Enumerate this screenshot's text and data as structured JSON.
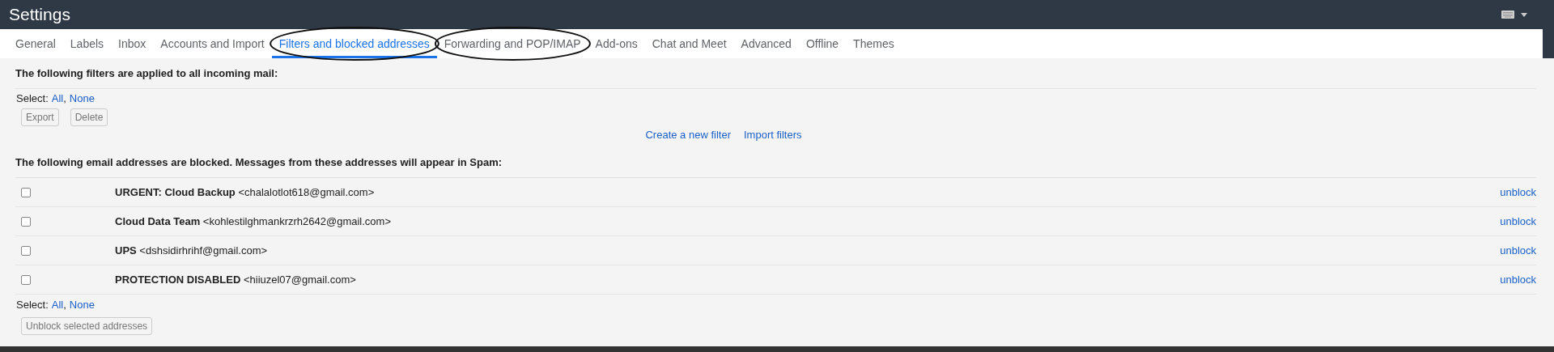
{
  "header": {
    "title": "Settings"
  },
  "tabs": [
    {
      "label": "General",
      "selected": false,
      "circled": false
    },
    {
      "label": "Labels",
      "selected": false,
      "circled": false
    },
    {
      "label": "Inbox",
      "selected": false,
      "circled": false
    },
    {
      "label": "Accounts and Import",
      "selected": false,
      "circled": false
    },
    {
      "label": "Filters and blocked addresses",
      "selected": true,
      "circled": true
    },
    {
      "label": "Forwarding and POP/IMAP",
      "selected": false,
      "circled": true
    },
    {
      "label": "Add-ons",
      "selected": false,
      "circled": false
    },
    {
      "label": "Chat and Meet",
      "selected": false,
      "circled": false
    },
    {
      "label": "Advanced",
      "selected": false,
      "circled": false
    },
    {
      "label": "Offline",
      "selected": false,
      "circled": false
    },
    {
      "label": "Themes",
      "selected": false,
      "circled": false
    }
  ],
  "filters": {
    "heading": "The following filters are applied to all incoming mail:",
    "select_label": "Select:",
    "select_all": "All",
    "separator": ",",
    "select_none": "None",
    "buttons": [
      "Export",
      "Delete"
    ],
    "links": [
      "Create a new filter",
      "Import filters"
    ]
  },
  "blocked": {
    "heading": "The following email addresses are blocked. Messages from these addresses will appear in Spam:",
    "rows": [
      {
        "name": "URGENT: Cloud Backup",
        "email": "<chalalotlot618@gmail.com>",
        "checked": false,
        "action": "unblock"
      },
      {
        "name": "Cloud Data Team",
        "email": "<kohlestilghmankrzrh2642@gmail.com>",
        "checked": false,
        "action": "unblock"
      },
      {
        "name": "UPS",
        "email": "<dshsidirhrihf@gmail.com>",
        "checked": false,
        "action": "unblock"
      },
      {
        "name": "PROTECTION DISABLED",
        "email": "<hiiuzel07@gmail.com>",
        "checked": false,
        "action": "unblock"
      }
    ],
    "select_label": "Select:",
    "select_all": "All",
    "separator": ",",
    "select_none": "None",
    "button": "Unblock selected addresses"
  }
}
